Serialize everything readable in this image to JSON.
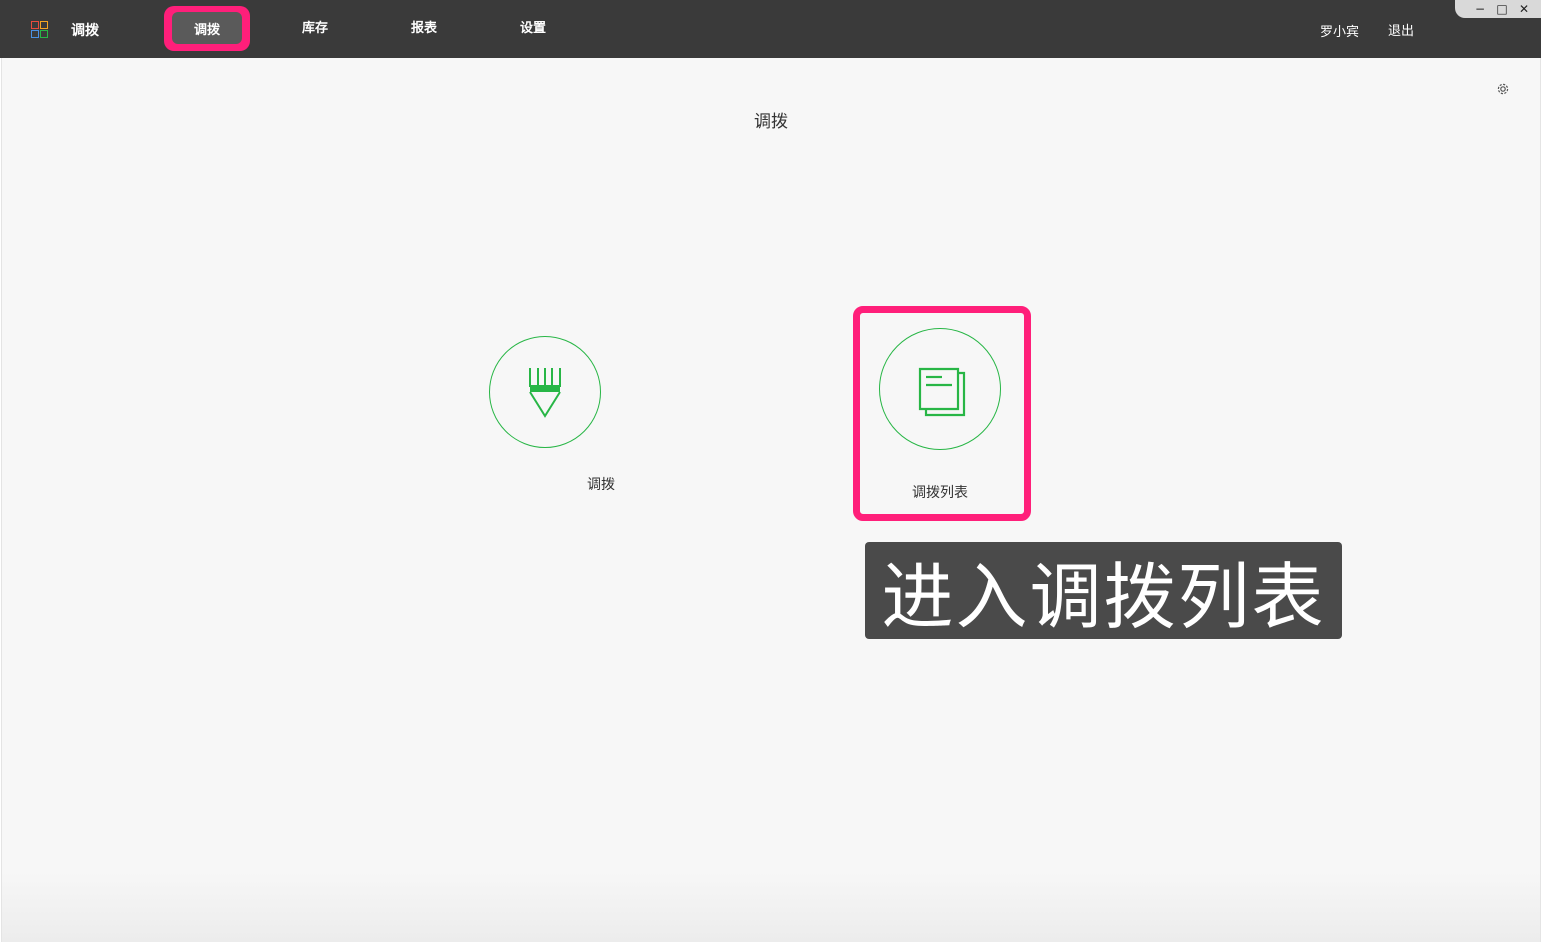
{
  "header": {
    "app_title": "调拨",
    "nav": [
      {
        "label": "调拨",
        "active": true
      },
      {
        "label": "库存"
      },
      {
        "label": "报表"
      },
      {
        "label": "设置"
      }
    ],
    "user_name": "罗小宾",
    "logout_label": "退出"
  },
  "window_controls": {
    "minimize": "−",
    "maximize": "□",
    "close": "✕"
  },
  "main": {
    "page_title": "调拨",
    "tiles": [
      {
        "label": "调拨",
        "icon": "pencil-icon"
      },
      {
        "label": "调拨列表",
        "icon": "document-list-icon"
      }
    ]
  },
  "annotation": {
    "callout_text": "进入调拨列表"
  },
  "colors": {
    "accent_green": "#28b646",
    "highlight_pink": "#ff1f7a",
    "topbar": "#3a3a3a"
  }
}
